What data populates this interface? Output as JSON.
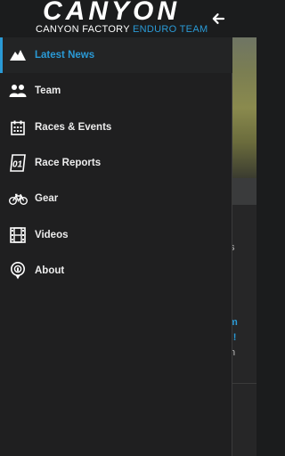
{
  "header": {
    "logo_title": "CANYON",
    "logo_subtitle_white": "CANYON FACTORY ",
    "logo_subtitle_accent": "ENDURO TEAM",
    "back_icon": "arrow-left-icon"
  },
  "nav": {
    "items": [
      {
        "label": "Latest News",
        "icon": "mountain-icon",
        "active": true
      },
      {
        "label": "Team",
        "icon": "team-icon",
        "active": false
      },
      {
        "label": "Races & Events",
        "icon": "calendar-icon",
        "active": false
      },
      {
        "label": "Race Reports",
        "icon": "race-number-icon",
        "active": false
      },
      {
        "label": "Gear",
        "icon": "bicycle-icon",
        "active": false
      },
      {
        "label": "Videos",
        "icon": "film-icon",
        "active": false
      },
      {
        "label": "About",
        "icon": "info-pin-icon",
        "active": false
      }
    ]
  },
  "background": {
    "fragments": [
      "s",
      "m",
      "n!",
      "n"
    ]
  },
  "colors": {
    "accent": "#2a9ad6",
    "drawer_bg": "#1f1f20",
    "header_bg": "#1b1c1d",
    "text": "#ececec"
  }
}
